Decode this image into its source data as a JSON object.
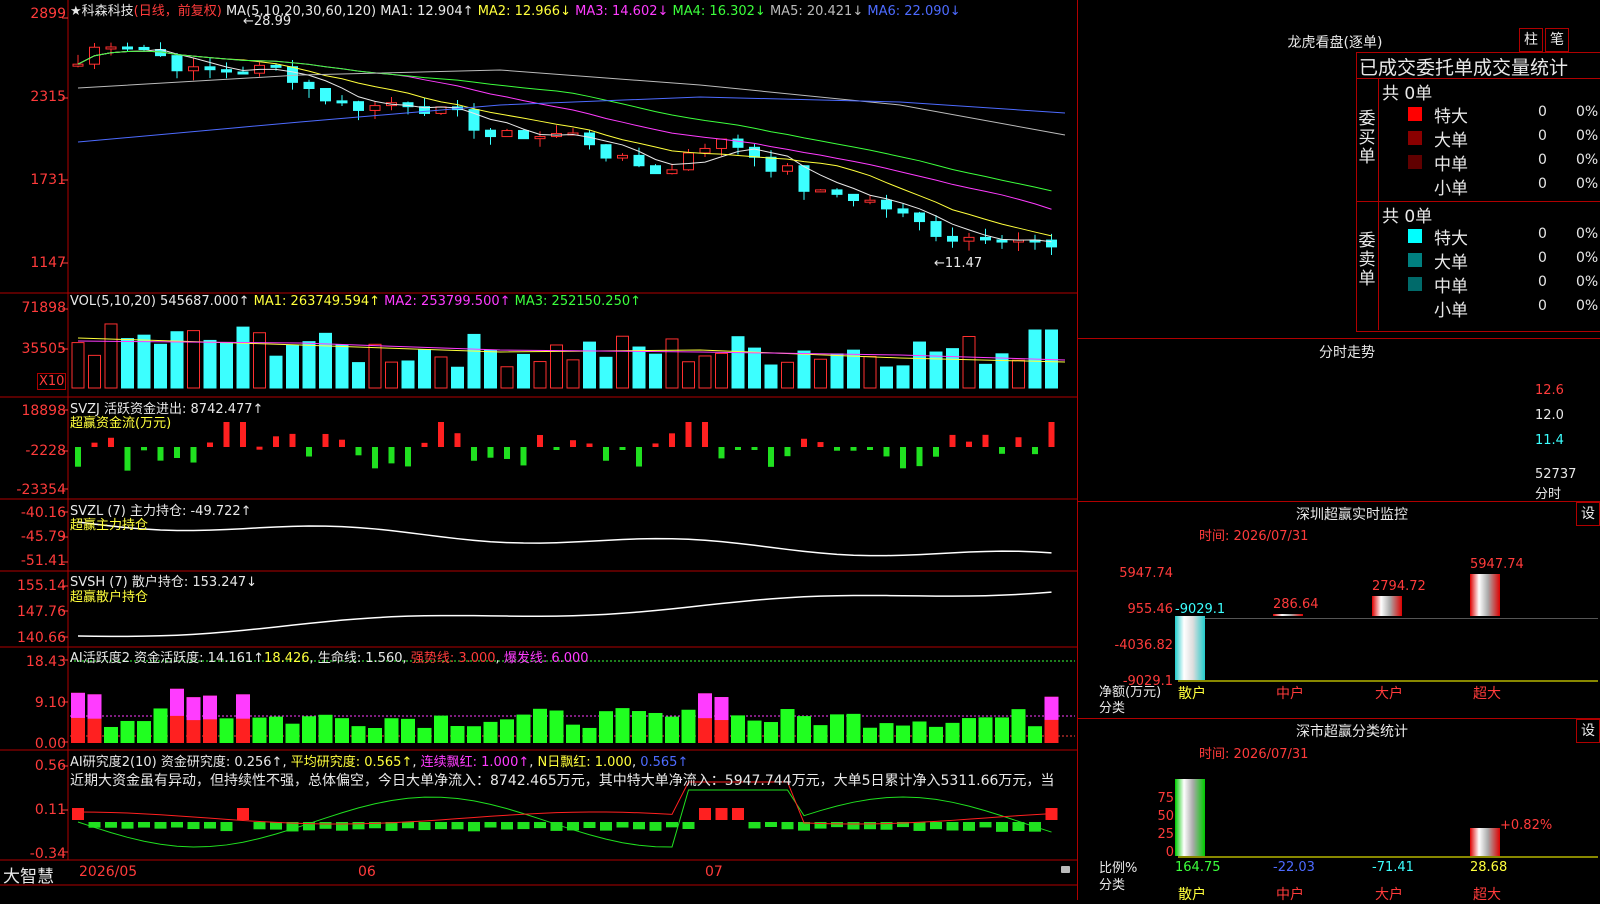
{
  "main_chart": {
    "stock_title": "★科森科技",
    "period_label": "(日线，前复权)",
    "ma_title": "MA(5,10,20,30,60,120)",
    "ma1": "MA1: 12.904↑",
    "ma2": "MA2: 12.966↓",
    "ma3": "MA3: 14.602↓",
    "ma4": "MA4: 16.302↓",
    "ma5": "MA5: 20.421↓",
    "ma6": "MA6: 22.090↓",
    "high_mark": "←28.99",
    "low_mark": "←11.47",
    "y_ticks": [
      "2899",
      "2315",
      "1731",
      "1147"
    ]
  },
  "vol_panel": {
    "title": "VOL(5,10,20)",
    "value": "545687.000↑",
    "ma1": "MA1: 263749.594↑",
    "ma2": "MA2: 253799.500↑",
    "ma3": "MA3: 252150.250↑",
    "y_ticks": [
      "71898",
      "35505"
    ],
    "unit": "X10"
  },
  "svzj_panel": {
    "title": "SVZJ  活跃资金进出: 8742.477↑",
    "subtitle": "超赢资金流(万元)",
    "y_ticks": [
      "18898",
      "-2228",
      "-23354"
    ]
  },
  "svzl_panel": {
    "title": "SVZL (7) 主力持仓: -49.722↑",
    "subtitle": "超赢主力持仓",
    "y_ticks": [
      "-40.16",
      "-45.79",
      "-51.41"
    ]
  },
  "svsh_panel": {
    "title": "SVSH (7) 散户持仓: 153.247↓",
    "subtitle": "超赢散户持仓",
    "y_ticks": [
      "155.14",
      "147.76",
      "140.66"
    ]
  },
  "ai_active_panel": {
    "title": "AI活跃度2",
    "t1": "资金活跃度: 14.161↑",
    "t2": "18.426",
    "t3": "生命线: 1.560",
    "t4": "强势线: 3.000",
    "t5": "爆发线: 6.000",
    "y_ticks": [
      "18.43",
      "9.10",
      "0.00"
    ]
  },
  "ai_research_panel": {
    "title": "AI研究度2(10)",
    "t1": "资金研究度: 0.256↑",
    "t2": "平均研究度: 0.565↑",
    "t3": "连续飘红: 1.000↑",
    "t4": "N日飘红: 1.000",
    "t5": "0.565↑",
    "comment": "近期大资金虽有异动，但持续性不强，总体偏空，今日大单净流入：8742.465万元，其中特大单净流入：5947.744万元，大单5日累计净入5311.66万元，当",
    "y_ticks": [
      "0.56",
      "0.11",
      "-0.34"
    ]
  },
  "bottom_bar": {
    "brand": "大智慧",
    "dates": [
      "2026/05",
      "06",
      "07"
    ]
  },
  "dragon_tiger": {
    "title": "龙虎看盘(逐单)",
    "btn1": "柱",
    "btn2": "笔",
    "header": "已成交委托单成交量统计",
    "buy_label": "委买单",
    "sell_label": "委卖单",
    "buy_total": "共 0单",
    "sell_total": "共 0单",
    "buy_rows": [
      {
        "label": "特大",
        "count": "0",
        "pct": "0%",
        "color": "#ff0000"
      },
      {
        "label": "大单",
        "count": "0",
        "pct": "0%",
        "color": "#8a0000"
      },
      {
        "label": "中单",
        "count": "0",
        "pct": "0%",
        "color": "#600000"
      },
      {
        "label": "小单",
        "count": "0",
        "pct": "0%",
        "color": "#000000"
      }
    ],
    "sell_rows": [
      {
        "label": "特大",
        "count": "0",
        "pct": "0%",
        "color": "#00ffff"
      },
      {
        "label": "大单",
        "count": "0",
        "pct": "0%",
        "color": "#008080"
      },
      {
        "label": "中单",
        "count": "0",
        "pct": "0%",
        "color": "#006a6a"
      },
      {
        "label": "小单",
        "count": "0",
        "pct": "0%",
        "color": "#000000"
      }
    ]
  },
  "intraday": {
    "title": "分时走势",
    "y1": "12.6",
    "y2": "12.0",
    "y3": "11.4",
    "vol": "52737",
    "label": "分时"
  },
  "sz_monitor": {
    "title": "深圳超赢实时监控",
    "settings": "设",
    "time": "时间: 2026/07/31",
    "y_ticks": [
      "5947.74",
      "955.46",
      "-4036.82",
      "-9029.1"
    ],
    "axis_name": "净额(万元)",
    "axis_cat": "分类",
    "categories": [
      "散户",
      "中户",
      "大户",
      "超大"
    ],
    "values": [
      -9029.1,
      286.64,
      2794.72,
      5947.74
    ],
    "value_labels": [
      "-9029.1",
      "286.64",
      "2794.72",
      "5947.74"
    ]
  },
  "sz_class": {
    "title": "深市超赢分类统计",
    "settings": "设",
    "time": "时间: 2026/07/31",
    "y_ticks": [
      "75",
      "50",
      "25",
      "0"
    ],
    "axis_name": "比例%",
    "axis_cat": "分类",
    "categories": [
      "散户",
      "中户",
      "大户",
      "超大"
    ],
    "values": [
      164.75,
      -22.03,
      -71.41,
      28.68
    ],
    "value_labels": [
      "164.75",
      "-22.03",
      "-71.41",
      "28.68"
    ],
    "annotation": "+0.82%"
  },
  "chart_data": {
    "type": "bar",
    "title": "",
    "categories": [
      "散户",
      "中户",
      "大户",
      "超大"
    ],
    "values": [
      -9029.1,
      286.64,
      2794.72,
      5947.74
    ],
    "ylabel": "净额(万元)",
    "xlabel": "分类",
    "ylim": [
      -9029.1,
      5947.74
    ]
  }
}
